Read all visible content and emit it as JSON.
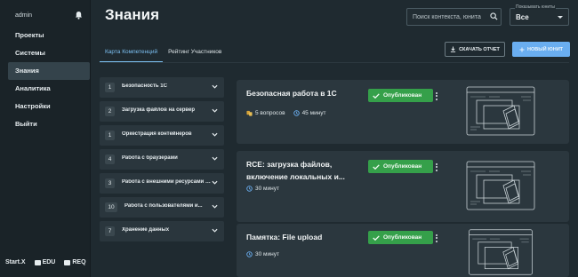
{
  "user": {
    "name": "admin"
  },
  "nav": [
    {
      "label": "Проекты"
    },
    {
      "label": "Системы"
    },
    {
      "label": "Знания",
      "active": true
    },
    {
      "label": "Аналитика"
    },
    {
      "label": "Настройки"
    },
    {
      "label": "Выйти"
    }
  ],
  "brands": [
    "Start.X",
    "EDU",
    "REQ"
  ],
  "page": {
    "title": "Знания"
  },
  "search": {
    "placeholder": "Поиск контекста, юнита"
  },
  "unit_filter": {
    "legend": "Показывать юниты",
    "value": "Все"
  },
  "tabs": [
    {
      "label": "Карта Компетенций",
      "active": true
    },
    {
      "label": "Рейтинг Участников"
    }
  ],
  "actions": {
    "download_report": "СКАЧАТЬ ОТЧЕТ",
    "new_unit": "НОВЫЙ ЮНИТ"
  },
  "competencies": [
    {
      "count": "1",
      "name": "Безопасность 1С"
    },
    {
      "count": "2",
      "name": "Загрузка файлов на сервер"
    },
    {
      "count": "1",
      "name": "Оркестрация контейнеров"
    },
    {
      "count": "4",
      "name": "Работа с браузерами"
    },
    {
      "count": "3",
      "name": "Работа с внешними ресурсами и..."
    },
    {
      "count": "10",
      "name": "Работа с пользователями и..."
    },
    {
      "count": "7",
      "name": "Хранение данных"
    }
  ],
  "units": [
    {
      "title": "Безопасная работа в 1С",
      "status": "Опубликован",
      "questions": "5 вопросов",
      "duration": "45 минут"
    },
    {
      "title": "RCE: загрузка файлов, включение локальных и...",
      "status": "Опубликован",
      "duration": "30 минут"
    },
    {
      "title": "Памятка: File upload",
      "status": "Опубликован",
      "duration": "30 минут"
    }
  ],
  "colors": {
    "accent": "#6aaef0",
    "published": "#35a04a",
    "background": "#1f2a30",
    "card": "#2b373e"
  }
}
